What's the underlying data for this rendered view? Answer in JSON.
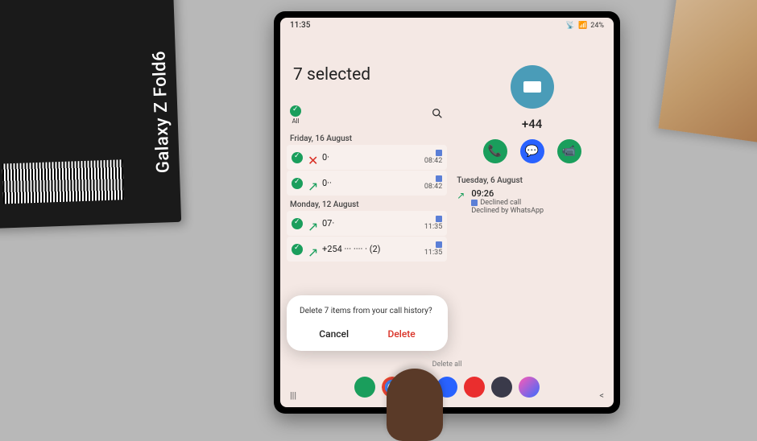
{
  "product_box": {
    "brand": "Galaxy Z Fold6"
  },
  "status": {
    "time": "11:35",
    "battery": "24%",
    "signal": "📶"
  },
  "header": {
    "title": "7 selected"
  },
  "toolbar": {
    "all_label": "All",
    "search_placeholder": "Search"
  },
  "sections": [
    {
      "date": "Friday, 16 August",
      "items": [
        {
          "direction": "missed",
          "number": "0·",
          "time": "08:42"
        },
        {
          "direction": "out",
          "number": "0··",
          "time": "08:42"
        }
      ]
    },
    {
      "date": "Monday, 12 August",
      "items": [
        {
          "direction": "out",
          "number": "07·",
          "time": "11:35"
        },
        {
          "direction": "out",
          "number": "+254 ··· ···· · (2)",
          "time": "11:35"
        }
      ]
    }
  ],
  "contact": {
    "number": "+44",
    "actions": {
      "call": "phone-icon",
      "message": "message-icon",
      "video": "video-icon"
    },
    "history_date": "Tuesday, 6 August",
    "history_time": "09:26",
    "history_status": "Declined call",
    "history_via": "Declined by WhatsApp"
  },
  "dialog": {
    "message": "Delete 7 items from your call history?",
    "cancel": "Cancel",
    "delete": "Delete"
  },
  "bottom_action": "Delete all",
  "dock": [
    "phone",
    "chrome",
    "purple",
    "blue",
    "red",
    "teal",
    "samsung"
  ]
}
